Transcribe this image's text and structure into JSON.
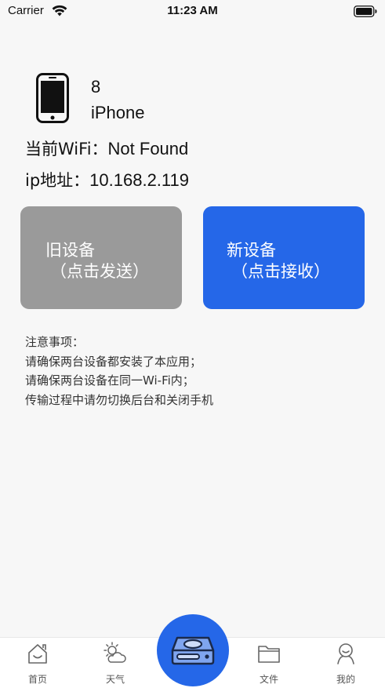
{
  "status_bar": {
    "carrier": "Carrier",
    "time": "11:23 AM"
  },
  "device": {
    "name_line1": "8",
    "name_line2": "iPhone",
    "icon": "smartphone-icon"
  },
  "network": {
    "wifi_label": "当前WiFi：",
    "wifi_value": "Not Found",
    "ip_label": "ip地址：",
    "ip_value": "10.168.2.119"
  },
  "buttons": {
    "old_device_title": "旧设备",
    "old_device_sub": "（点击发送）",
    "new_device_title": "新设备",
    "new_device_sub": "（点击接收）"
  },
  "notes": {
    "title": "注意事项：",
    "items": [
      "请确保两台设备都安装了本应用；",
      "请确保两台设备在同一Wi-Fi内；",
      "传输过程中请勿切换后台和关闭手机"
    ]
  },
  "tab_bar": {
    "home": "首页",
    "weather": "天气",
    "files": "文件",
    "me": "我的"
  },
  "colors": {
    "accent": "#2567e8",
    "old_button": "#9a9a9a",
    "background": "#f7f7f7"
  }
}
